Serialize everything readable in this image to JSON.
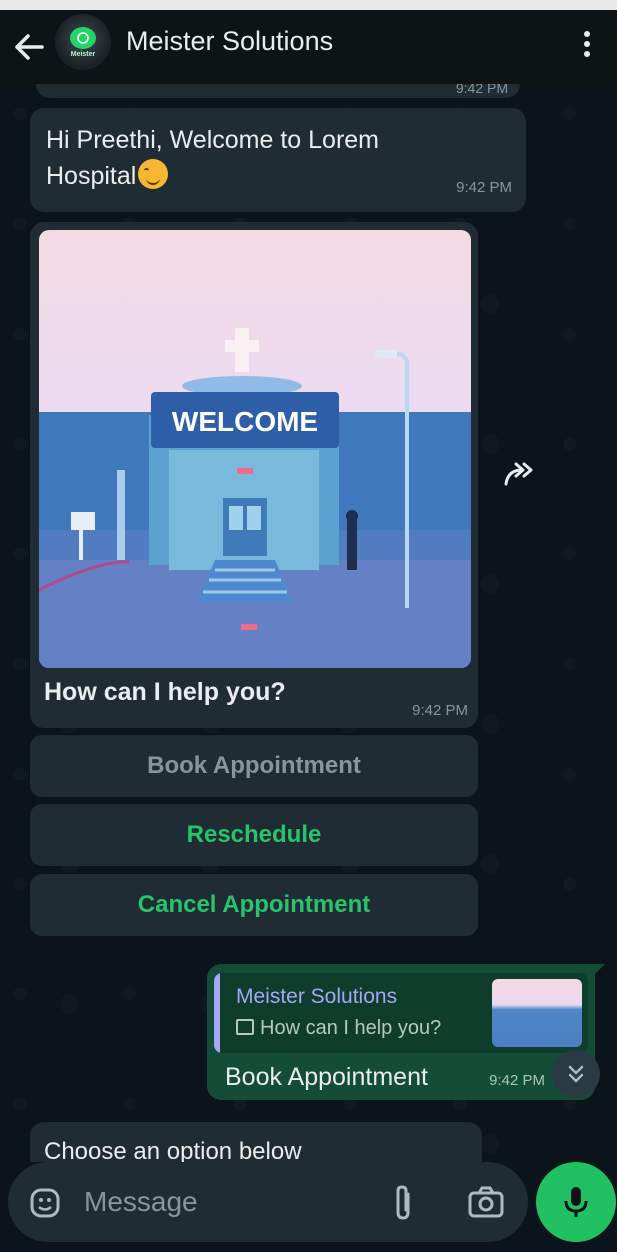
{
  "header": {
    "title": "Meister Solutions",
    "avatar_text": "Meister"
  },
  "messages": {
    "previous_time": "9:42 PM",
    "welcome_text": "Hi Preethi, Welcome to Lorem Hospital",
    "welcome_time": "9:42 PM",
    "image_banner_text": "WELCOME",
    "prompt_text": "How can I help you?",
    "prompt_time": "9:42 PM",
    "options": [
      "Book Appointment",
      "Reschedule",
      "Cancel Appointment"
    ],
    "reply": {
      "quoted_name": "Meister Solutions",
      "quoted_text": "How can I help you?",
      "text": "Book Appointment",
      "time": "9:42 PM"
    },
    "next_text": "Choose an option below"
  },
  "composer": {
    "placeholder": "Message"
  },
  "colors": {
    "background": "#0b141a",
    "incoming_bubble": "#202c33",
    "outgoing_bubble": "#134d37",
    "accent_green": "#21c063",
    "quote_accent": "#a5a6f6"
  },
  "icons": [
    "back-arrow-icon",
    "more-vert-icon",
    "forward-icon",
    "chevron-double-down-icon",
    "sticker-icon",
    "attach-icon",
    "camera-icon",
    "mic-icon"
  ]
}
